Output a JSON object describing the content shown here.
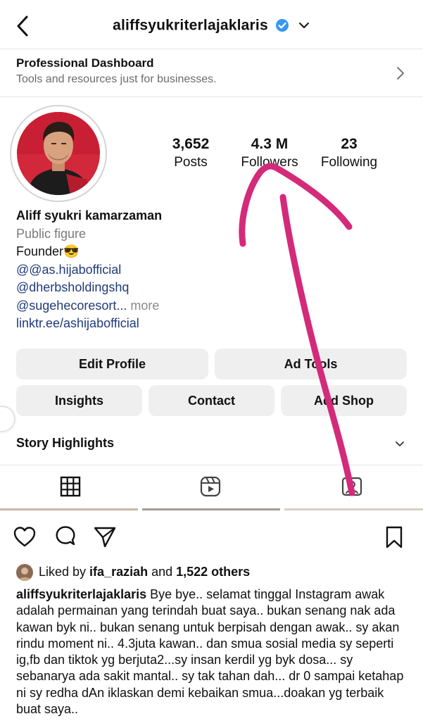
{
  "header": {
    "username": "aliffsyukriterlajaklaris"
  },
  "dashboard": {
    "title": "Professional Dashboard",
    "subtitle": "Tools and resources just for businesses."
  },
  "stats": {
    "posts_count": "3,652",
    "posts_label": "Posts",
    "followers_count": "4.3 M",
    "followers_label": "Followers",
    "following_count": "23",
    "following_label": "Following"
  },
  "bio": {
    "name": "Aliff syukri kamarzaman",
    "category": "Public figure",
    "line1": "Founder😎",
    "mention1": "@@as.hijabofficial",
    "mention2": "@dherbsholdingshq",
    "mention3": "@sugehecoresort...",
    "more": " more",
    "link": "linktr.ee/ashijabofficial"
  },
  "buttons": {
    "edit_profile": "Edit Profile",
    "ad_tools": "Ad Tools",
    "insights": "Insights",
    "contact": "Contact",
    "add_shop": "Add Shop"
  },
  "story_highlights": "Story Highlights",
  "tabs": [
    "grid-icon",
    "reels-icon",
    "tagged-icon"
  ],
  "post": {
    "liked_prefix": "Liked by ",
    "liked_user": "ifa_raziah",
    "liked_and": " and ",
    "liked_others": "1,522 others",
    "caption_user": "aliffsyukriterlajaklaris",
    "caption_text": " Bye bye.. selamat tinggal Instagram awak adalah permainan yang terindah buat saya.. bukan senang nak ada kawan byk ni.. bukan senang untuk berpisah dengan awak.. sy akan rindu moment ni.. 4.3juta kawan.. dan smua sosial media sy seperti ig,fb dan tiktok yg berjuta2...sy insan kerdil yg byk dosa... sy sebanarya ada sakit mantal.. sy tak tahan dah... dr 0 sampai ketahap ni sy redha dAn iklaskan demi kebaikan smua...doakan yg terbaik buat saya.."
  },
  "colors": {
    "verified": "#3897f0",
    "link": "#1f3b7a",
    "button_bg": "#efefef",
    "annotation": "#d42a7a"
  }
}
